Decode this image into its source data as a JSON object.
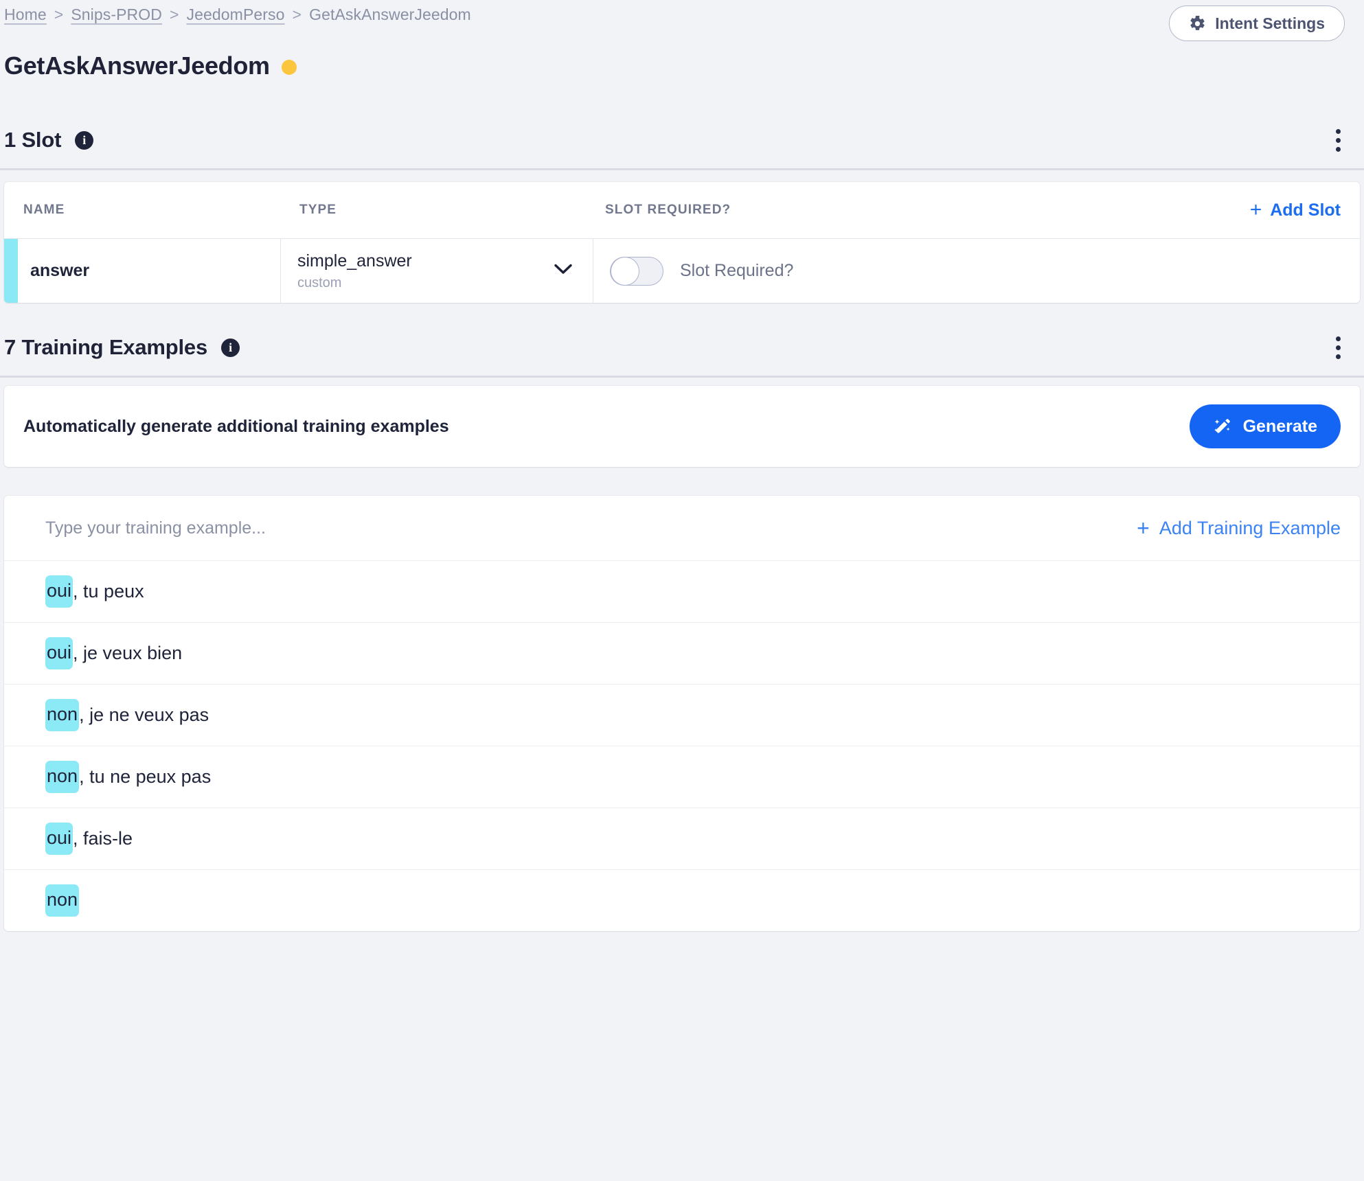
{
  "breadcrumb": {
    "items": [
      {
        "label": "Home",
        "type": "link"
      },
      {
        "label": "Snips-PROD",
        "type": "link"
      },
      {
        "label": "JeedomPerso",
        "type": "link"
      },
      {
        "label": "GetAskAnswerJeedom",
        "type": "current"
      }
    ],
    "separator": ">"
  },
  "header": {
    "intent_settings_label": "Intent Settings",
    "gear_icon": "gear-icon",
    "title": "GetAskAnswerJeedom",
    "status_dot_color": "#fcc53e"
  },
  "slots_section": {
    "title": "1 Slot",
    "info_icon": "info-icon",
    "info_glyph": "i",
    "menu_icon": "kebab-menu-icon",
    "columns": {
      "name": "NAME",
      "type": "TYPE",
      "required": "SLOT REQUIRED?"
    },
    "add_slot_label": "Add Slot",
    "add_icon": "+",
    "rows": [
      {
        "name": "answer",
        "type": "simple_answer",
        "type_origin": "custom",
        "required_label": "Slot Required?",
        "required_value": false,
        "accent_color": "#8ae9f4"
      }
    ]
  },
  "training_section": {
    "title": "7 Training Examples",
    "info_glyph": "i",
    "menu_icon": "kebab-menu-icon",
    "generate": {
      "description": "Automatically generate additional training examples",
      "button_label": "Generate",
      "button_icon": "magic-wand-icon",
      "button_color": "#1565f5"
    },
    "input_placeholder": "Type your training example...",
    "input_value": "",
    "add_example_label": "Add Training Example",
    "add_icon": "+",
    "highlight_color": "#8ce9f6",
    "examples": [
      {
        "slot_text": "oui",
        "rest": ", tu peux"
      },
      {
        "slot_text": "oui",
        "rest": ", je veux bien"
      },
      {
        "slot_text": "non",
        "rest": ", je ne veux pas"
      },
      {
        "slot_text": "non",
        "rest": ", tu ne peux pas"
      },
      {
        "slot_text": "oui",
        "rest": ", fais-le"
      },
      {
        "slot_text": "non",
        "rest": ""
      }
    ]
  }
}
